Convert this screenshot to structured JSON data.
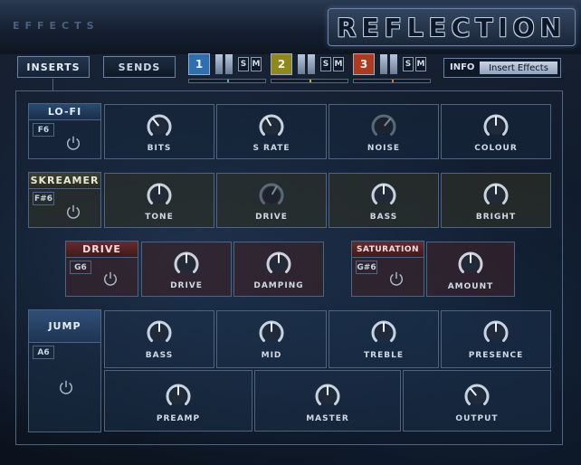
{
  "header": {
    "effects_label": "EFFECTS",
    "logo_text": "REFLECTION"
  },
  "tabs": {
    "inserts": "INSERTS",
    "sends": "SENDS"
  },
  "buses": [
    {
      "number": "1",
      "solo": "S",
      "mute": "M",
      "color": "#2d6fb0",
      "meter_color": "#5aa8c8"
    },
    {
      "number": "2",
      "solo": "S",
      "mute": "M",
      "color": "#8f8a18",
      "meter_color": "#c8a64a"
    },
    {
      "number": "3",
      "solo": "S",
      "mute": "M",
      "color": "#b03a1e",
      "meter_color": "#d07a3a"
    }
  ],
  "info": {
    "label": "INFO",
    "value": "Insert Effects"
  },
  "modules": {
    "lofi": {
      "title": "LO-FI",
      "key": "F6",
      "knobs": [
        "BITS",
        "S RATE",
        "NOISE",
        "COLOUR"
      ]
    },
    "skreamer": {
      "title": "SKREAMER",
      "key": "F#6",
      "knobs": [
        "TONE",
        "DRIVE",
        "BASS",
        "BRIGHT"
      ]
    },
    "drive": {
      "title": "DRIVE",
      "key": "G6",
      "knobs": [
        "DRIVE",
        "DAMPING"
      ]
    },
    "saturation": {
      "title": "SATURATION",
      "key": "G#6",
      "knobs": [
        "AMOUNT"
      ]
    },
    "jump": {
      "title": "JUMP",
      "key": "A6",
      "knobs_top": [
        "BASS",
        "MID",
        "TREBLE",
        "PRESENCE"
      ],
      "knobs_bottom": [
        "PREAMP",
        "MASTER",
        "OUTPUT"
      ]
    }
  },
  "colors": {
    "accent": "#6a84a8",
    "panel_border": "#4f6480",
    "lofi": "#2a4a70",
    "skreamer": "#3d4230",
    "drive": "#6a2a2a",
    "jump": "#2f4f78"
  }
}
